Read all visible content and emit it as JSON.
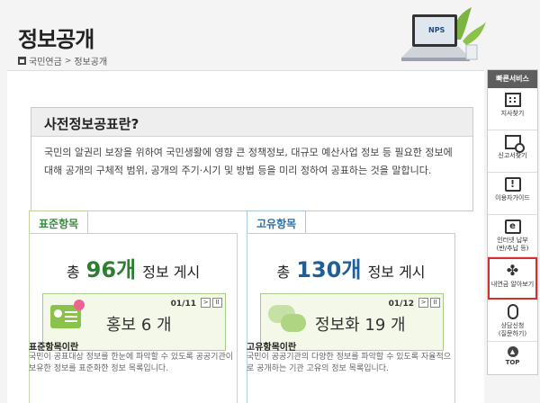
{
  "header": {
    "title": "정보공개",
    "breadcrumb": [
      "국민연금",
      "정보공개"
    ],
    "laptop_logo": "NPS"
  },
  "pre_disclosure": {
    "title": "사전정보공표란?",
    "text_line1": "국민의 알권리 보장을 위하여 국민생활에 영향 큰 정책정보, 대규모 예산사업 정보 등 필요한 정보에",
    "text_line2": "대해 공개의 구체적 범위, 공개의 주기·시기 및 방법 등을 미리 정하여 공표하는 것을 말합니다."
  },
  "standard": {
    "tab_label": "표준항목",
    "count_prefix": "총",
    "count_number": "96개",
    "count_suffix": "정보 게시",
    "banner_page": "01/11",
    "banner_label": "홍보 6 개",
    "desc_title": "표준항목이란",
    "desc_text": "국민이 공표대상 정보를 한눈에 파악할 수 있도록 공공기관이 보유한 정보를 표준화한 정보 목록입니다."
  },
  "unique": {
    "tab_label": "고유항목",
    "count_prefix": "총",
    "count_number": "130개",
    "count_suffix": "정보 게시",
    "banner_page": "01/12",
    "banner_label": "정보화 19 개",
    "desc_title": "고유항목이란",
    "desc_text": "국민이 공공기관의 다양한 정보를 파악할 수 있도록 자율적으로 공개하는 기관 고유의 정보 목록입니다."
  },
  "banner_controls": {
    "next": ">",
    "pause": "II"
  },
  "quick_menu": {
    "title": "빠른서비스",
    "items": [
      {
        "line1": "지사찾기",
        "line2": "",
        "icon": "building-icon"
      },
      {
        "line1": "신고서찾기",
        "line2": "",
        "icon": "search-document-icon"
      },
      {
        "line1": "이용자가이드",
        "line2": "",
        "icon": "guide-icon",
        "glyph": "!"
      },
      {
        "line1": "인터넷 납부",
        "line2": "(반/추납 등)",
        "icon": "web-icon",
        "glyph": "e"
      },
      {
        "line1": "내연금 알아보기",
        "line2": "",
        "icon": "clover-icon",
        "glyph": "✤"
      },
      {
        "line1": "상담신청",
        "line2": "(질문하기)",
        "icon": "mouse-icon"
      }
    ],
    "top_label": "TOP"
  },
  "colors": {
    "standard_accent": "#2e7d32",
    "unique_accent": "#1d5f96",
    "highlight_border": "#d32f2f"
  }
}
